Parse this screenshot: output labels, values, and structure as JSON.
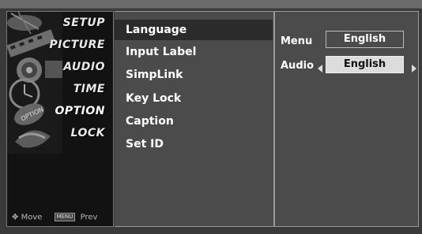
{
  "categories": [
    {
      "label": "SETUP",
      "icon": "satellite-dish-icon"
    },
    {
      "label": "PICTURE",
      "icon": "filmstrip-icon"
    },
    {
      "label": "AUDIO",
      "icon": "speaker-icon"
    },
    {
      "label": "TIME",
      "icon": "clock-icon"
    },
    {
      "label": "OPTION",
      "icon": "option-badge-icon"
    },
    {
      "label": "LOCK",
      "icon": "lock-icon"
    }
  ],
  "hint": {
    "move_label": "Move",
    "menu_key": "MENU",
    "prev_label": "Prev"
  },
  "submenu": [
    {
      "label": "Language",
      "selected": true
    },
    {
      "label": "Input Label"
    },
    {
      "label": "SimpLink"
    },
    {
      "label": "Key Lock"
    },
    {
      "label": "Caption"
    },
    {
      "label": "Set ID"
    }
  ],
  "settings": {
    "menu": {
      "label": "Menu",
      "value": "English"
    },
    "audio": {
      "label": "Audio",
      "value": "English"
    }
  },
  "colors": {
    "background": "#3a3a3a",
    "panel": "#4b4b4b",
    "selected_row": "#2b2b2b",
    "focused_value": "#dcdcdc"
  }
}
